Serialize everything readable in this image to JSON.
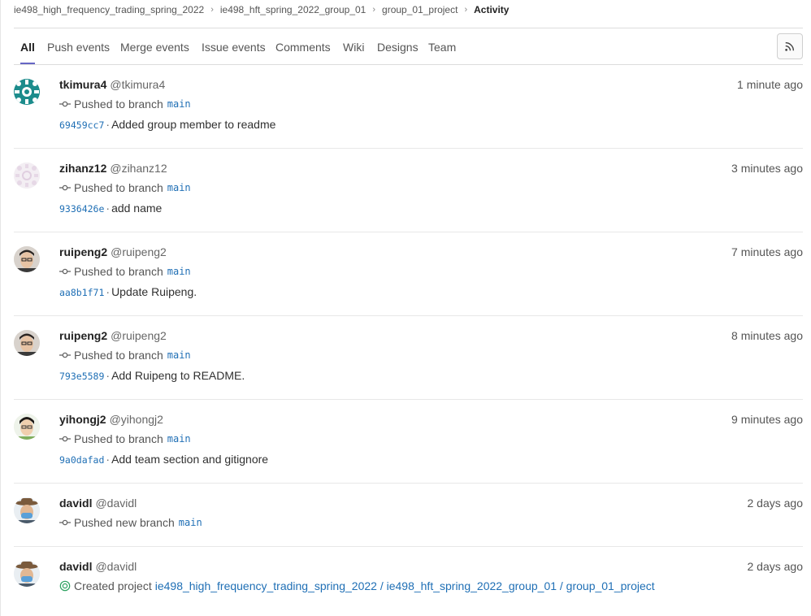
{
  "breadcrumb": {
    "items": [
      "ie498_high_frequency_trading_spring_2022",
      "ie498_hft_spring_2022_group_01",
      "group_01_project"
    ],
    "current": "Activity"
  },
  "tabs": [
    "All",
    "Push events",
    "Merge events",
    "Issue events",
    "Comments",
    "Wiki",
    "Designs",
    "Team"
  ],
  "rss": {
    "icon": "rss-icon"
  },
  "events": [
    {
      "name": "tkimura4",
      "handle": "@tkimura4",
      "time": "1 minute ago",
      "action": "Pushed to branch",
      "branch": "main",
      "sha": "69459cc7",
      "message": "Added group member to readme"
    },
    {
      "name": "zihanz12",
      "handle": "@zihanz12",
      "time": "3 minutes ago",
      "action": "Pushed to branch",
      "branch": "main",
      "sha": "9336426e",
      "message": "add name"
    },
    {
      "name": "ruipeng2",
      "handle": "@ruipeng2",
      "time": "7 minutes ago",
      "action": "Pushed to branch",
      "branch": "main",
      "sha": "aa8b1f71",
      "message": "Update Ruipeng."
    },
    {
      "name": "ruipeng2",
      "handle": "@ruipeng2",
      "time": "8 minutes ago",
      "action": "Pushed to branch",
      "branch": "main",
      "sha": "793e5589",
      "message": "Add Ruipeng to README."
    },
    {
      "name": "yihongj2",
      "handle": "@yihongj2",
      "time": "9 minutes ago",
      "action": "Pushed to branch",
      "branch": "main",
      "sha": "9a0dafad",
      "message": "Add team section and gitignore"
    },
    {
      "name": "davidl",
      "handle": "@davidl",
      "time": "2 days ago",
      "action": "Pushed new branch",
      "branch": "main"
    },
    {
      "name": "davidl",
      "handle": "@davidl",
      "time": "2 days ago",
      "action": "Created project",
      "project": "ie498_high_frequency_trading_spring_2022 / ie498_hft_spring_2022_group_01 / group_01_project"
    }
  ],
  "colors": {
    "accent": "#6666c4",
    "link": "#1f6fb5",
    "created": "#2da160"
  }
}
